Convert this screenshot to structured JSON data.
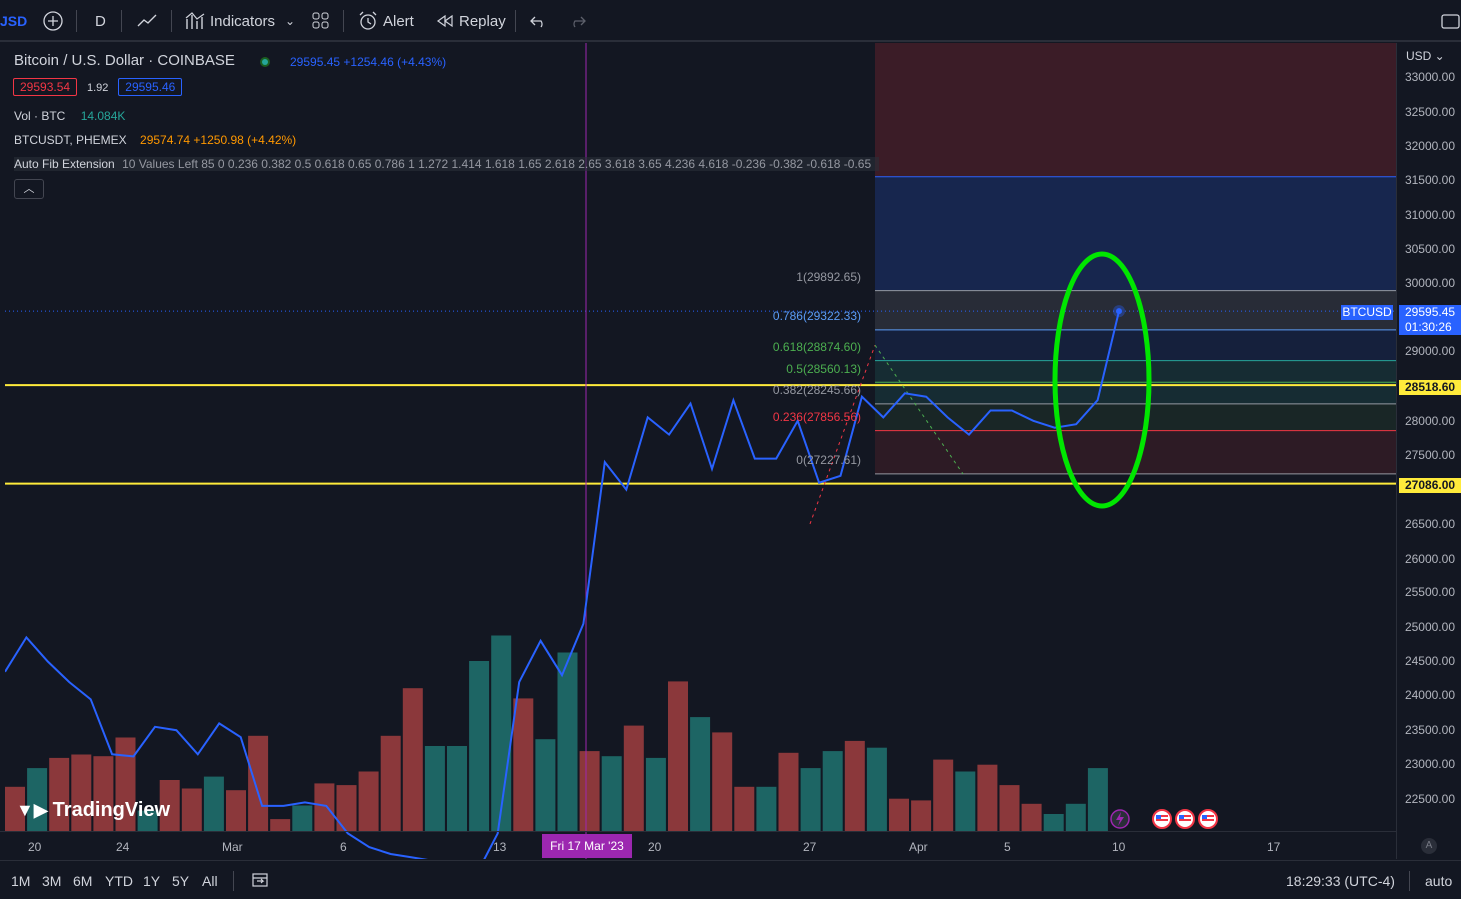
{
  "toolbar": {
    "symbol_partial": "JSD",
    "interval": "D",
    "indicators": "Indicators",
    "alert": "Alert",
    "replay": "Replay"
  },
  "legend": {
    "title": "Bitcoin / U.S. Dollar · COINBASE",
    "price_line": "29595.45 +1254.46 (+4.43%)",
    "bid": "29593.54",
    "spread": "1.92",
    "ask": "29595.46",
    "vol_label": "Vol · BTC",
    "vol_value": "14.084K",
    "compare_symbol": "BTCUSDT, PHEMEX",
    "compare_value": "29574.74 +1250.98 (+4.42%)",
    "fib_name": "Auto Fib Extension",
    "fib_params": "10 Values Left 85 0 0.236 0.382 0.5 0.618 0.65 0.786 1 1.272 1.414 1.618 1.65 2.618 2.65 3.618 3.65 4.236 4.618 -0.236 -0.382 -0.618 -0.65"
  },
  "currency": "USD",
  "price_ticks": [
    "33000.00",
    "32500.00",
    "32000.00",
    "31500.00",
    "31000.00",
    "30500.00",
    "30000.00",
    "29000.00",
    "28000.00",
    "27500.00",
    "26500.00",
    "26000.00",
    "25500.00",
    "25000.00",
    "24500.00",
    "24000.00",
    "23500.00",
    "23000.00",
    "22500.00"
  ],
  "time_labels": [
    "20",
    "24",
    "Mar",
    "6",
    "13",
    "20",
    "27",
    "Apr",
    "5",
    "10",
    "17"
  ],
  "crosshair_date": "Fri 17 Mar '23",
  "fib_levels": [
    {
      "label": "1(29892.65)",
      "color": "#9598a1"
    },
    {
      "label": "0.786(29322.33)",
      "color": "#5b9cf6"
    },
    {
      "label": "0.618(28874.60)",
      "color": "#4caf50"
    },
    {
      "label": "0.5(28560.13)",
      "color": "#4caf50"
    },
    {
      "label": "0.382(28245.66)",
      "color": "#9598a1"
    },
    {
      "label": "0.236(27856.56)",
      "color": "#f23645"
    },
    {
      "label": "0(27227.61)",
      "color": "#9598a1"
    }
  ],
  "price_tags": {
    "symbol": "BTCUSD",
    "last_price": "29595.45",
    "countdown": "01:30:26",
    "upper_line": "28518.60",
    "lower_line": "27086.00"
  },
  "bottom": {
    "ranges": [
      "1M",
      "3M",
      "6M",
      "YTD",
      "1Y",
      "5Y",
      "All"
    ],
    "clock": "18:29:33 (UTC-4)",
    "scale": "auto"
  },
  "logo_text": "TradingView",
  "colors": {
    "up": "#26a69a",
    "down": "#ef5350",
    "line": "#2962ff",
    "yellow": "#ffeb3b",
    "green_circle": "#00e600",
    "crosshair": "#9c27b0"
  },
  "chart_data": {
    "type": "line",
    "y_range": [
      22000,
      33300
    ],
    "price_series_points": [
      24350,
      24850,
      24500,
      24200,
      23950,
      23150,
      23120,
      23550,
      23500,
      23150,
      23600,
      23400,
      22400,
      22400,
      22450,
      22400,
      22000,
      21800,
      21700,
      21650,
      21600,
      21400,
      21400,
      22000,
      24200,
      24800,
      24300,
      25050,
      27400,
      27000,
      28050,
      27800,
      28250,
      27300,
      28300,
      27450,
      27450,
      28000,
      27100,
      27200,
      28350,
      28050,
      28400,
      28350,
      28050,
      27800,
      28150,
      28150,
      28000,
      27900,
      27950,
      28300,
      29595
    ],
    "volume_bars": [
      {
        "v": 0.26,
        "up": false
      },
      {
        "v": 0.37,
        "up": true
      },
      {
        "v": 0.43,
        "up": false
      },
      {
        "v": 0.45,
        "up": false
      },
      {
        "v": 0.44,
        "up": false
      },
      {
        "v": 0.55,
        "up": false
      },
      {
        "v": 0.12,
        "up": true
      },
      {
        "v": 0.3,
        "up": false
      },
      {
        "v": 0.25,
        "up": false
      },
      {
        "v": 0.32,
        "up": true
      },
      {
        "v": 0.24,
        "up": false
      },
      {
        "v": 0.56,
        "up": false
      },
      {
        "v": 0.07,
        "up": false
      },
      {
        "v": 0.15,
        "up": true
      },
      {
        "v": 0.28,
        "up": false
      },
      {
        "v": 0.27,
        "up": false
      },
      {
        "v": 0.35,
        "up": false
      },
      {
        "v": 0.56,
        "up": false
      },
      {
        "v": 0.84,
        "up": false
      },
      {
        "v": 0.5,
        "up": true
      },
      {
        "v": 0.5,
        "up": true
      },
      {
        "v": 1.0,
        "up": true
      },
      {
        "v": 1.15,
        "up": true
      },
      {
        "v": 0.78,
        "up": false
      },
      {
        "v": 0.54,
        "up": true
      },
      {
        "v": 1.05,
        "up": true
      },
      {
        "v": 0.47,
        "up": false
      },
      {
        "v": 0.44,
        "up": true
      },
      {
        "v": 0.62,
        "up": false
      },
      {
        "v": 0.43,
        "up": true
      },
      {
        "v": 0.88,
        "up": false
      },
      {
        "v": 0.67,
        "up": true
      },
      {
        "v": 0.58,
        "up": false
      },
      {
        "v": 0.26,
        "up": false
      },
      {
        "v": 0.26,
        "up": true
      },
      {
        "v": 0.46,
        "up": false
      },
      {
        "v": 0.37,
        "up": true
      },
      {
        "v": 0.47,
        "up": true
      },
      {
        "v": 0.53,
        "up": false
      },
      {
        "v": 0.49,
        "up": true
      },
      {
        "v": 0.19,
        "up": false
      },
      {
        "v": 0.18,
        "up": false
      },
      {
        "v": 0.42,
        "up": false
      },
      {
        "v": 0.35,
        "up": true
      },
      {
        "v": 0.39,
        "up": false
      },
      {
        "v": 0.27,
        "up": false
      },
      {
        "v": 0.16,
        "up": false
      },
      {
        "v": 0.1,
        "up": true
      },
      {
        "v": 0.16,
        "up": true
      },
      {
        "v": 0.37,
        "up": true
      }
    ],
    "horizontal_lines": [
      28518.6,
      27086.0
    ],
    "fib_prices": [
      29892.65,
      29322.33,
      28874.6,
      28560.13,
      28245.66,
      27856.56,
      27227.61,
      31550
    ]
  }
}
